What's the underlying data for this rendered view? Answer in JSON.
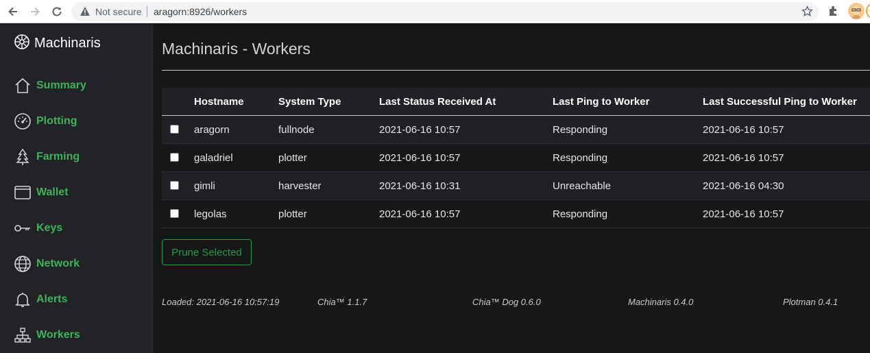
{
  "browser": {
    "security_label": "Not secure",
    "url": "aragorn:8926/workers"
  },
  "sidebar": {
    "brand": "Machinaris",
    "items": [
      {
        "label": "Summary",
        "icon": "house-icon"
      },
      {
        "label": "Plotting",
        "icon": "speedometer-icon"
      },
      {
        "label": "Farming",
        "icon": "tree-icon"
      },
      {
        "label": "Wallet",
        "icon": "wallet-icon"
      },
      {
        "label": "Keys",
        "icon": "key-icon"
      },
      {
        "label": "Network",
        "icon": "globe-icon"
      },
      {
        "label": "Alerts",
        "icon": "bell-icon"
      },
      {
        "label": "Workers",
        "icon": "diagram-icon"
      }
    ]
  },
  "main": {
    "title": "Machinaris - Workers",
    "table": {
      "headers": [
        "Hostname",
        "System Type",
        "Last Status Received At",
        "Last Ping to Worker",
        "Last Successful Ping to Worker"
      ],
      "rows": [
        [
          "aragorn",
          "fullnode",
          "2021-06-16 10:57",
          "Responding",
          "2021-06-16 10:57"
        ],
        [
          "galadriel",
          "plotter",
          "2021-06-16 10:57",
          "Responding",
          "2021-06-16 10:57"
        ],
        [
          "gimli",
          "harvester",
          "2021-06-16 10:31",
          "Unreachable",
          "2021-06-16 04:30"
        ],
        [
          "legolas",
          "plotter",
          "2021-06-16 10:57",
          "Responding",
          "2021-06-16 10:57"
        ]
      ]
    },
    "prune_label": "Prune Selected"
  },
  "footer": {
    "loaded": "Loaded: 2021-06-16 10:57:19",
    "chia": "Chia™ 1.1.7",
    "chiadog": "Chia™ Dog 0.6.0",
    "machinaris": "Machinaris 0.4.0",
    "plotman": "Plotman 0.4.1"
  },
  "colors": {
    "accent": "#3fb35a",
    "sidebar_bg": "#212327",
    "page_bg": "#161719"
  }
}
